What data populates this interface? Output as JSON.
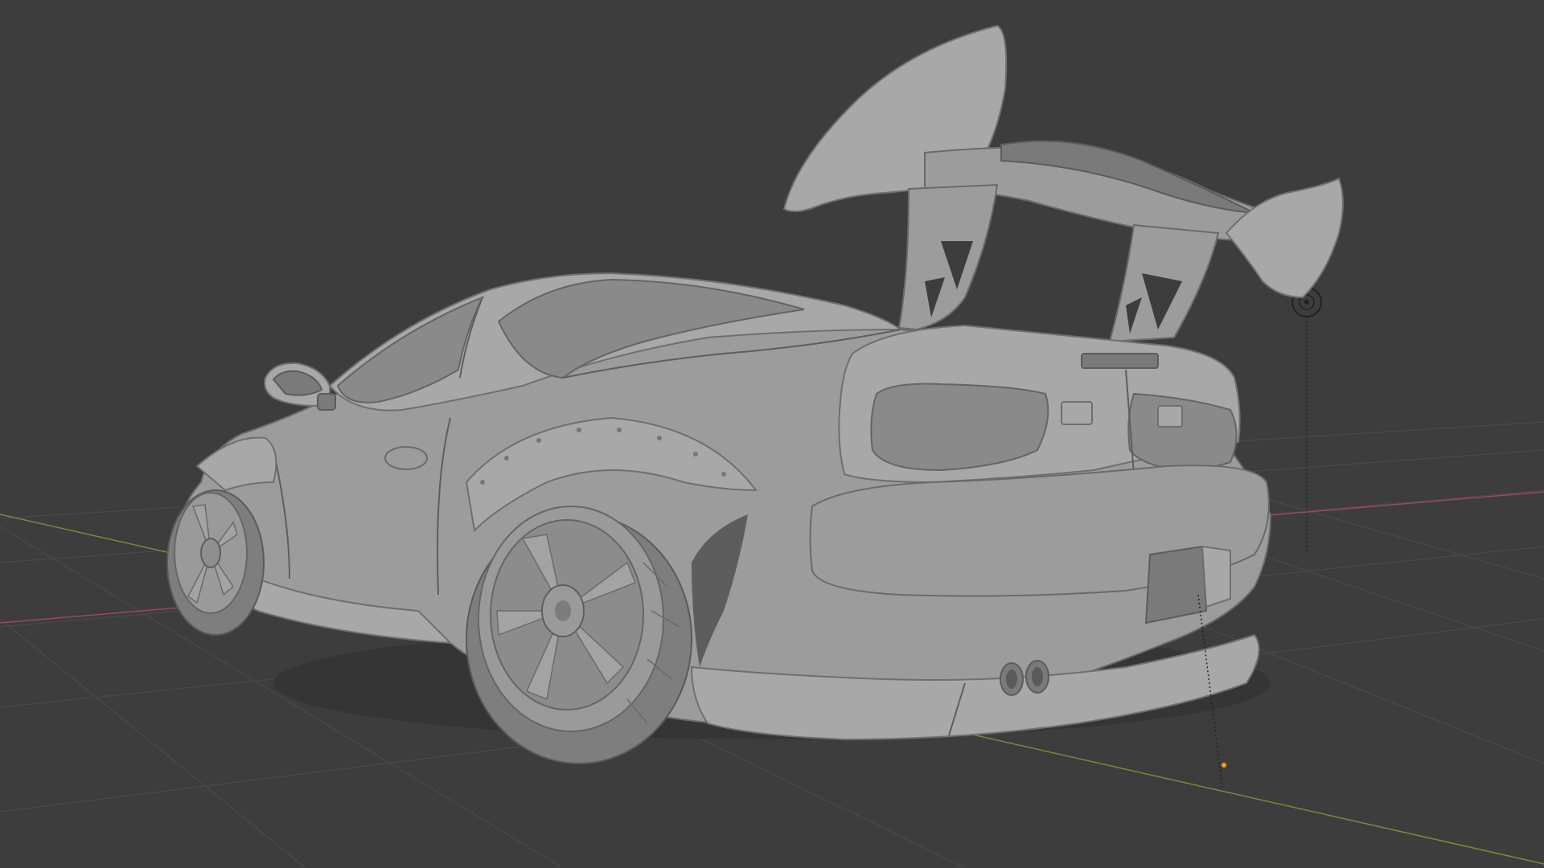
{
  "viewport": {
    "background": "#3d3d3d",
    "grid_color": "#4a4a4a",
    "x_axis_color": "#9b4a55",
    "y_axis_color": "#6f8f3a",
    "model_color": "#9c9c9c",
    "origin_point_color": "#ff9a1a",
    "object": "car-model",
    "shading": "solid"
  },
  "icons": {
    "light_empty": "light-empty-icon",
    "object_origin": "origin-point-icon"
  }
}
